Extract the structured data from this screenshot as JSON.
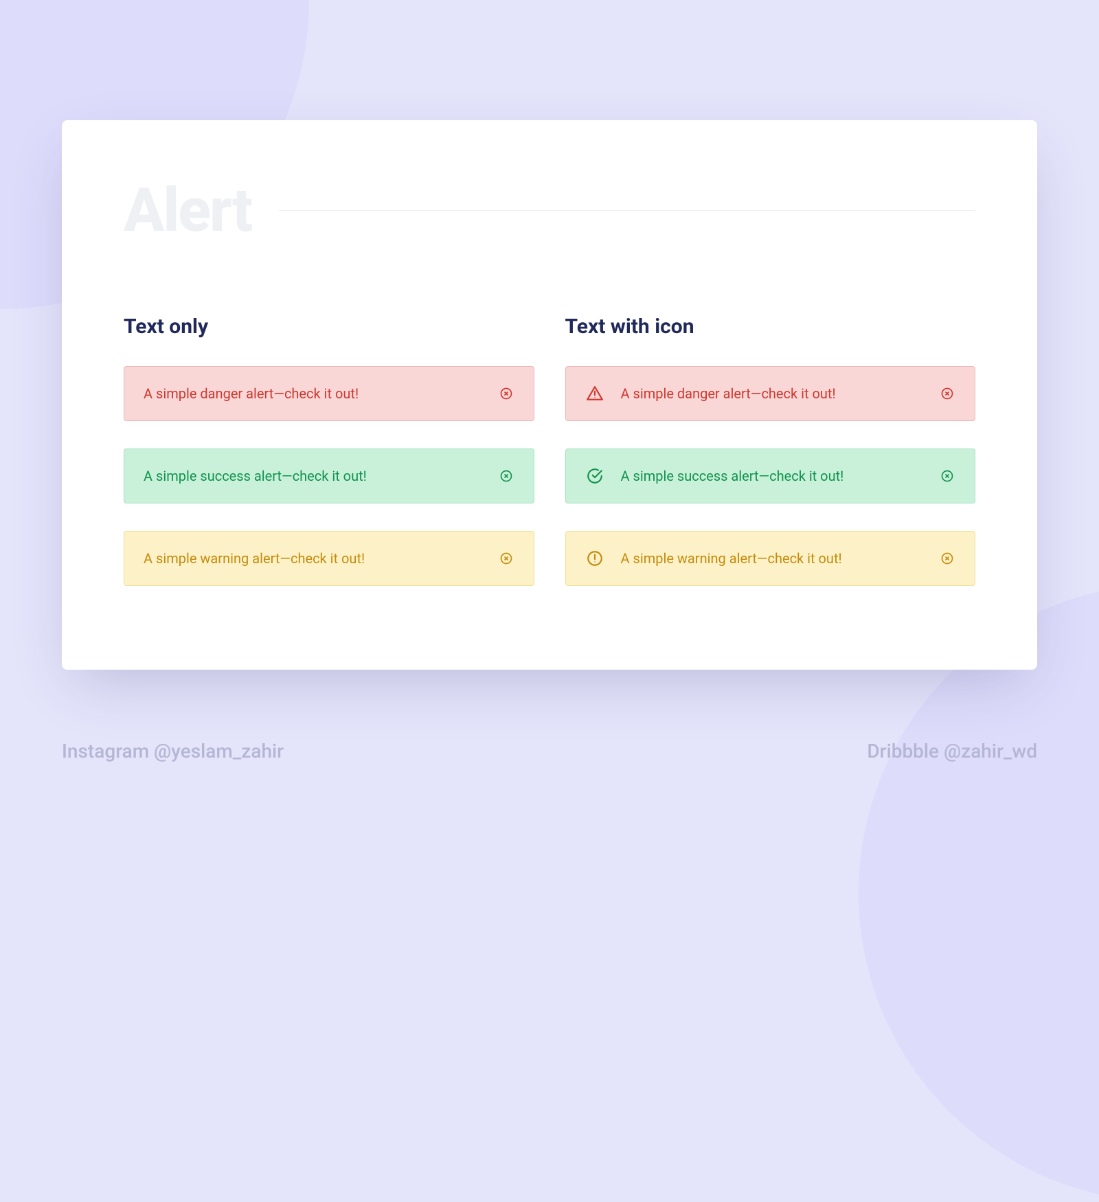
{
  "title": "Alert",
  "columns": {
    "text_only": {
      "heading": "Text only",
      "alerts": [
        {
          "variant": "danger",
          "message": "A simple danger alert—check it out!"
        },
        {
          "variant": "success",
          "message": "A simple success alert—check it out!"
        },
        {
          "variant": "warning",
          "message": "A simple warning alert—check it out!"
        }
      ]
    },
    "text_with_icon": {
      "heading": "Text with icon",
      "alerts": [
        {
          "variant": "danger",
          "message": "A simple danger alert—check it out!"
        },
        {
          "variant": "success",
          "message": "A simple success alert—check it out!"
        },
        {
          "variant": "warning",
          "message": "A simple warning alert—check it out!"
        }
      ]
    }
  },
  "colors": {
    "danger": {
      "bg": "#f9d7d7",
      "border": "#ecb8b8",
      "text": "#d0382e"
    },
    "success": {
      "bg": "#c9f1da",
      "border": "#a6e0be",
      "text": "#12924e"
    },
    "warning": {
      "bg": "#fcf1c7",
      "border": "#f2e09a",
      "text": "#c58c0d"
    }
  },
  "footer": {
    "instagram": "Instagram @yeslam_zahir",
    "dribbble": "Dribbble @zahir_wd"
  }
}
